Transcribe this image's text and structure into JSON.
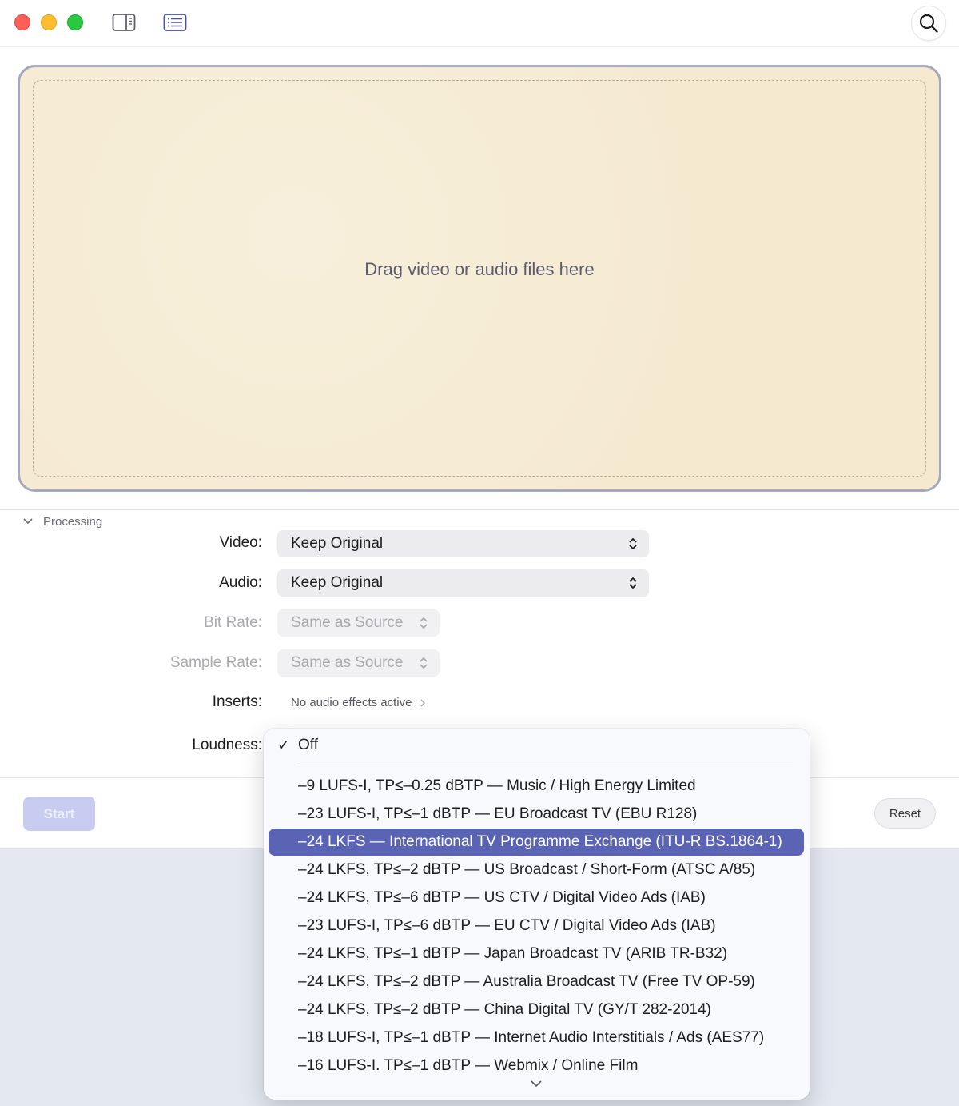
{
  "dropzone": {
    "label": "Drag video or audio files here"
  },
  "processing": {
    "title": "Processing",
    "video": {
      "label": "Video:",
      "value": "Keep Original"
    },
    "audio": {
      "label": "Audio:",
      "value": "Keep Original"
    },
    "bitrate": {
      "label": "Bit Rate:",
      "value": "Same as Source"
    },
    "samplerate": {
      "label": "Sample Rate:",
      "value": "Same as Source"
    },
    "inserts": {
      "label": "Inserts:",
      "value": "No audio effects active"
    },
    "loudness": {
      "label": "Loudness:"
    }
  },
  "footer": {
    "start": "Start",
    "reset": "Reset"
  },
  "loudness_menu": {
    "selected": "Off",
    "items": [
      "–9 LUFS-I, TP≤–0.25 dBTP — Music / High Energy Limited",
      "–23 LUFS-I, TP≤–1 dBTP — EU Broadcast TV (EBU R128)",
      "–24 LKFS — International TV Programme Exchange (ITU-R BS.1864-1)",
      "–24 LKFS, TP≤–2 dBTP — US Broadcast / Short-Form (ATSC A/85)",
      "–24 LKFS, TP≤–6 dBTP — US CTV / Digital Video Ads (IAB)",
      "–23 LUFS-I, TP≤–6 dBTP — EU CTV / Digital Video Ads (IAB)",
      "–24 LKFS, TP≤–1 dBTP — Japan Broadcast TV (ARIB TR-B32)",
      "–24 LKFS, TP≤–2 dBTP — Australia Broadcast TV (Free TV OP-59)",
      "–24 LKFS, TP≤–2 dBTP — China Digital TV (GY/T 282-2014)",
      "–18 LUFS-I, TP≤–1 dBTP — Internet Audio Interstitials / Ads (AES77)",
      "–16 LUFS-I. TP≤–1 dBTP — Webmix / Online Film"
    ]
  },
  "colors": {
    "accent": "#5a63b4",
    "dropzone_bg": "#f5ead0",
    "dropzone_border": "#a6a8c2",
    "start_disabled": "#c9ccf1"
  }
}
